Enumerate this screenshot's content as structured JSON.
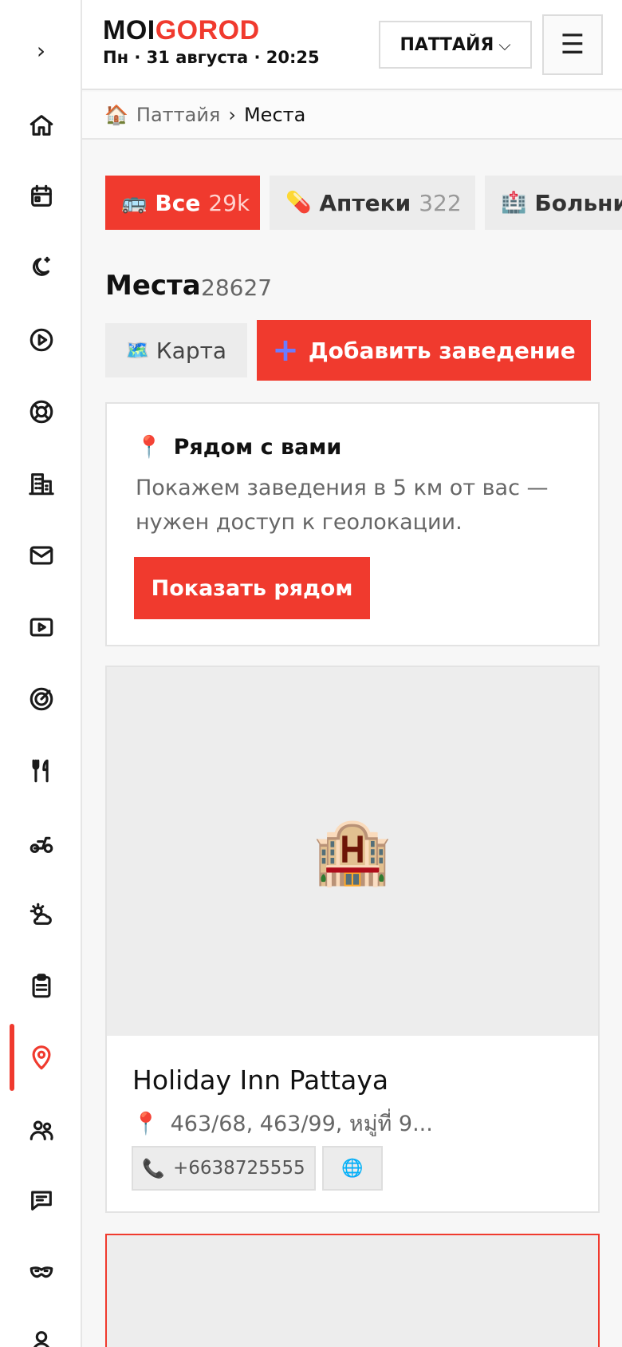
{
  "logo": {
    "part1": "MOI",
    "part2": "GOROD"
  },
  "dateline": "Пн · 31 августа · 20:25",
  "city": {
    "label": "ПАТТАЙЯ",
    "chevron": "⌵"
  },
  "menu": {
    "icon": "☰"
  },
  "sidebar": {
    "toggle": "›",
    "items": [
      {
        "icon": "home-icon"
      },
      {
        "icon": "calendar-icon"
      },
      {
        "icon": "moon-icon"
      },
      {
        "icon": "play-circle-icon"
      },
      {
        "icon": "lifebuoy-icon"
      },
      {
        "icon": "buildings-icon"
      },
      {
        "icon": "mail-icon"
      },
      {
        "icon": "video-icon"
      },
      {
        "icon": "target-icon"
      },
      {
        "icon": "fork-knife-icon"
      },
      {
        "icon": "scooter-icon"
      },
      {
        "icon": "weather-icon"
      },
      {
        "icon": "clipboard-icon"
      },
      {
        "icon": "map-pin-icon",
        "active": true
      },
      {
        "icon": "people-icon"
      },
      {
        "icon": "chat-icon"
      },
      {
        "icon": "mask-icon"
      },
      {
        "icon": "user-icon"
      }
    ]
  },
  "breadcrumb": {
    "home_icon": "🏠",
    "crumb1": "Паттайя",
    "sep": "›",
    "crumb2": "Места"
  },
  "tabs": [
    {
      "icon": "🚌",
      "label": "Все",
      "count": "29k"
    },
    {
      "icon": "💊",
      "label": "Аптеки",
      "count": "322"
    },
    {
      "icon": "🏥",
      "label": "Больни"
    }
  ],
  "places": {
    "title": "Места",
    "count": "28627"
  },
  "map_button": {
    "icon": "🗺️",
    "label": "Карта"
  },
  "add_button": {
    "icon": "+",
    "label": "Добавить заведение"
  },
  "nearby": {
    "icon": "📍",
    "title": "Рядом с вами",
    "text": "Покажем заведения в 5 км от вас — нужен доступ к геолокации.",
    "button": "Показать рядом"
  },
  "place_card": {
    "image_icon": "🏨",
    "name": "Holiday Inn Pattaya",
    "addr_icon": "📍",
    "address": "463/68, 463/99, หมู่ที่ 9...",
    "phone_icon": "📞",
    "phone": "+6638725555",
    "web_icon": "🌐"
  },
  "colors": {
    "accent": "#f03a2e"
  }
}
